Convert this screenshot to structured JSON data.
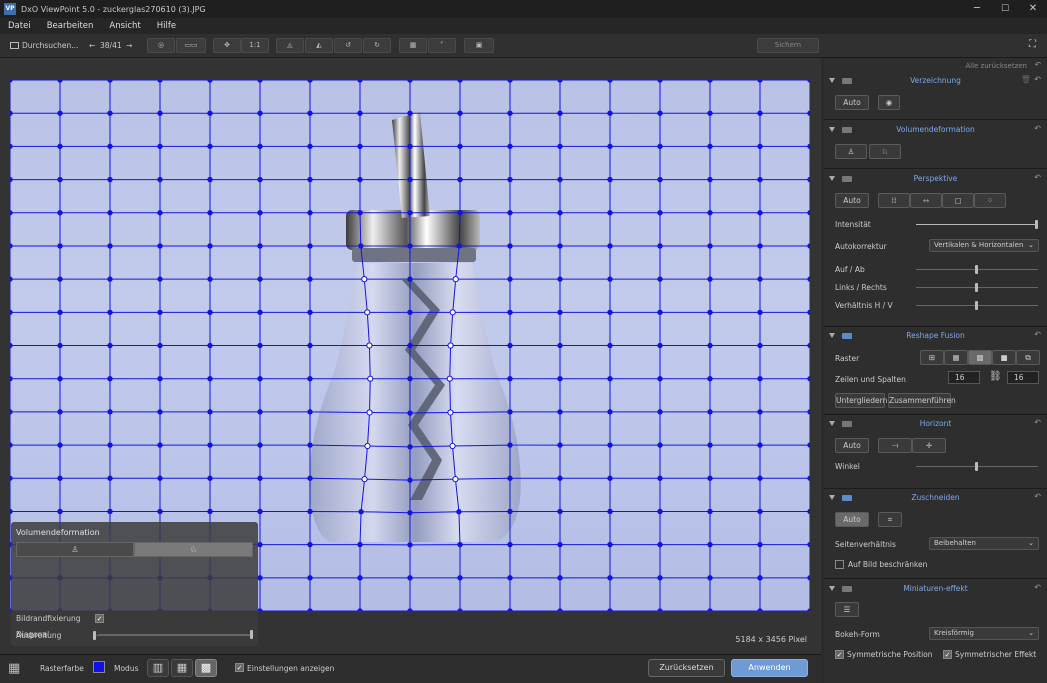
{
  "window": {
    "title": "DxO ViewPoint 5.0 - zuckerglas270610 (3).JPG",
    "min": "─",
    "max": "☐",
    "close": "✕"
  },
  "menu": [
    "Datei",
    "Bearbeiten",
    "Ansicht",
    "Hilfe"
  ],
  "toolbar": {
    "browse": "Durchsuchen...",
    "counter": "38/41",
    "zoom_label": "1:1",
    "save": "Sichern"
  },
  "viewer": {
    "pixel_info": "5184 x 3456 Pixel"
  },
  "vol_panel": {
    "title": "Volumendeformation",
    "diagonal": "Diagonal",
    "border_fix": "Bildrandfixierung",
    "spread": "Ausbreitung"
  },
  "bottom": {
    "grid_color": "Rasterfarbe",
    "mode": "Modus",
    "show_settings": "Einstellungen anzeigen",
    "reset": "Zurücksetzen",
    "apply": "Anwenden"
  },
  "colors": {
    "grid": "#1414e0",
    "accent": "#7fa8e8"
  },
  "side": {
    "reset_all": "Alle zurücksetzen",
    "distortion": {
      "name": "Verzeichnung",
      "auto": "Auto"
    },
    "volume": {
      "name": "Volumendeformation"
    },
    "perspective": {
      "name": "Perspektive",
      "auto": "Auto",
      "intensity": "Intensität",
      "autocorrect": "Autokorrektur",
      "autocorrect_value": "Vertikalen & Horizontalen",
      "updown": "Auf / Ab",
      "leftright": "Links / Rechts",
      "ratio": "Verhältnis H / V"
    },
    "reshape": {
      "name": "Reshape Fusion",
      "grid": "Raster",
      "rowscols": "Zeilen und Spalten",
      "rows": "16",
      "cols": "16",
      "subdivide": "Untergliedern",
      "merge": "Zusammenführen"
    },
    "horizon": {
      "name": "Horizont",
      "auto": "Auto",
      "angle": "Winkel"
    },
    "crop": {
      "name": "Zuschneiden",
      "auto": "Auto",
      "aspect": "Seitenverhältnis",
      "aspect_value": "Beibehalten",
      "restrict": "Auf Bild beschränken"
    },
    "miniature": {
      "name": "Miniaturen-effekt",
      "bokeh": "Bokeh-Form",
      "bokeh_value": "Kreisförmig",
      "sym_pos": "Symmetrische Position",
      "sym_eff": "Symmetrischer Effekt"
    }
  }
}
